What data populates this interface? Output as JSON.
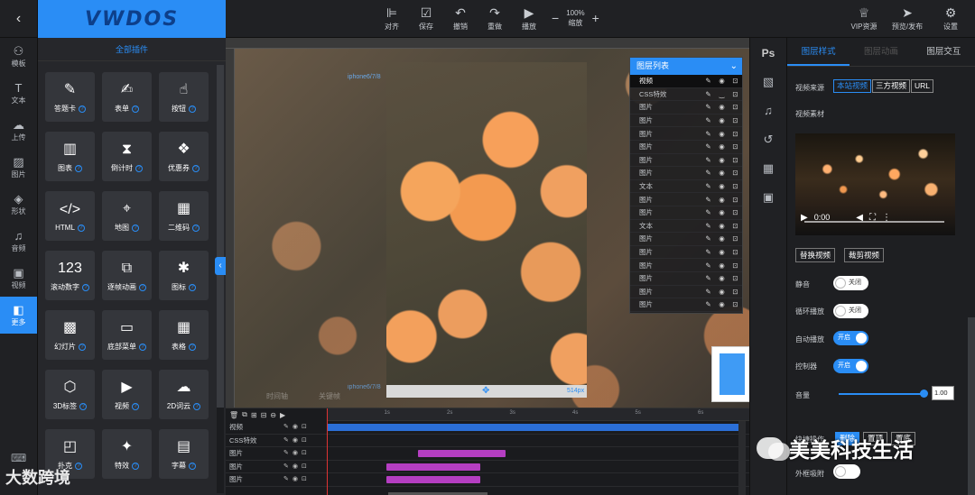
{
  "logo": "VWDOS",
  "topbar": {
    "tools": [
      {
        "icon": "align-icon",
        "glyph": "⊫",
        "label": "对齐"
      },
      {
        "icon": "save-icon",
        "glyph": "☑",
        "label": "保存"
      },
      {
        "icon": "undo-icon",
        "glyph": "↶",
        "label": "撤销"
      },
      {
        "icon": "redo-icon",
        "glyph": "↷",
        "label": "重做"
      },
      {
        "icon": "play-icon",
        "glyph": "▶",
        "label": "播放"
      }
    ],
    "zoom": {
      "minus": "−",
      "value": "100%",
      "label": "缩放",
      "plus": "+"
    },
    "right": [
      {
        "icon": "vip-icon",
        "glyph": "♕",
        "label": "VIP资源"
      },
      {
        "icon": "publish-icon",
        "glyph": "➤",
        "label": "预览/发布"
      },
      {
        "icon": "settings-icon",
        "glyph": "⚙",
        "label": "设置"
      }
    ]
  },
  "rail": [
    {
      "name": "templates",
      "glyph": "⚇",
      "label": "模板",
      "active": false
    },
    {
      "name": "text",
      "glyph": "T",
      "label": "文本",
      "active": false
    },
    {
      "name": "upload",
      "glyph": "☁",
      "label": "上传",
      "active": false
    },
    {
      "name": "image",
      "glyph": "▨",
      "label": "图片",
      "active": false
    },
    {
      "name": "shape",
      "glyph": "◈",
      "label": "形状",
      "active": false
    },
    {
      "name": "audio",
      "glyph": "♫",
      "label": "音频",
      "active": false
    },
    {
      "name": "video",
      "glyph": "▣",
      "label": "视频",
      "active": false
    },
    {
      "name": "more",
      "glyph": "◧",
      "label": "更多",
      "active": true
    }
  ],
  "widgets": {
    "title": "全部插件",
    "items": [
      {
        "icon": "edit-icon",
        "glyph": "✎",
        "label": "答题卡"
      },
      {
        "icon": "form-icon",
        "glyph": "✍",
        "label": "表单"
      },
      {
        "icon": "button-icon",
        "glyph": "☝",
        "label": "按钮"
      },
      {
        "icon": "chart-icon",
        "glyph": "▥",
        "label": "图表"
      },
      {
        "icon": "hourglass-icon",
        "glyph": "⧗",
        "label": "倒计时"
      },
      {
        "icon": "coupon-icon",
        "glyph": "❖",
        "label": "优惠券"
      },
      {
        "icon": "code-icon",
        "glyph": "</>",
        "label": "HTML"
      },
      {
        "icon": "map-pin-icon",
        "glyph": "⌖",
        "label": "地图"
      },
      {
        "icon": "qrcode-icon",
        "glyph": "▦",
        "label": "二维码"
      },
      {
        "icon": "number-icon",
        "glyph": "123",
        "label": "滚动数字"
      },
      {
        "icon": "frames-icon",
        "glyph": "⧉",
        "label": "逐帧动画"
      },
      {
        "icon": "star-icon",
        "glyph": "✱",
        "label": "图标"
      },
      {
        "icon": "slideshow-icon",
        "glyph": "▩",
        "label": "幻灯片"
      },
      {
        "icon": "bottom-menu-icon",
        "glyph": "▭",
        "label": "底部菜单"
      },
      {
        "icon": "table-icon",
        "glyph": "▦",
        "label": "表格"
      },
      {
        "icon": "cube-icon",
        "glyph": "⬡",
        "label": "3D标签"
      },
      {
        "icon": "video-icon",
        "glyph": "▶",
        "label": "视频"
      },
      {
        "icon": "cloud-icon",
        "glyph": "☁",
        "label": "2D词云"
      },
      {
        "icon": "shapes-icon",
        "glyph": "◰",
        "label": "扑克"
      },
      {
        "icon": "magic-icon",
        "glyph": "✦",
        "label": "特效"
      },
      {
        "icon": "subtitle-icon",
        "glyph": "▤",
        "label": "字幕"
      }
    ]
  },
  "canvas": {
    "phone_label_top": "iphone6/7/8",
    "phone_label_bottom": "iphone6/7/8",
    "phone_size": "514px",
    "move_glyph": "✥",
    "faded_left": "时间轴",
    "faded_mid": "关键帧"
  },
  "layers": {
    "title": "图层列表",
    "rows": [
      "视频",
      "CSS特效",
      "图片",
      "图片",
      "图片",
      "图片",
      "图片",
      "图片",
      "文本",
      "图片",
      "图片",
      "文本",
      "图片",
      "图片",
      "图片",
      "图片",
      "图片",
      "图片"
    ]
  },
  "timeline": {
    "tools": [
      "🗑",
      "⧉",
      "⊞",
      "⊟",
      "⊖",
      "▶"
    ],
    "ticks": [
      "1s",
      "2s",
      "3s",
      "4s",
      "5s",
      "6s"
    ],
    "rows": [
      {
        "name": "视频",
        "bar": {
          "start": 0.0,
          "end": 6.6,
          "color": "#2b6fd6"
        }
      },
      {
        "name": "CSS特效",
        "bar": null
      },
      {
        "name": "图片",
        "bar": {
          "start": 1.45,
          "end": 2.85,
          "color": "#b53ec2"
        }
      },
      {
        "name": "图片",
        "bar": {
          "start": 0.95,
          "end": 2.45,
          "color": "#b53ec2"
        }
      },
      {
        "name": "图片",
        "bar": {
          "start": 0.95,
          "end": 2.45,
          "color": "#b53ec2"
        }
      }
    ]
  },
  "rstrip": [
    {
      "icon": "photoshop-icon",
      "glyph": "Ps"
    },
    {
      "icon": "texture-icon",
      "glyph": "▧"
    },
    {
      "icon": "music-icon",
      "glyph": "♫"
    },
    {
      "icon": "history-icon",
      "glyph": "↺"
    },
    {
      "icon": "grid-icon",
      "glyph": "▦"
    },
    {
      "icon": "image-frame-icon",
      "glyph": "▣"
    }
  ],
  "props": {
    "tabs": [
      "图层样式",
      "图层动画",
      "图层交互"
    ],
    "source_label": "视频来源",
    "source_options": [
      "本站视频",
      "三方视频",
      "URL"
    ],
    "material_label": "视频素材",
    "video_time": "0:00",
    "replace_btn": "替换视频",
    "crop_btn": "裁剪视频",
    "mute_label": "静音",
    "mute_state": "关闭",
    "loop_label": "循环播放",
    "loop_state": "关闭",
    "autoplay_label": "自动播放",
    "autoplay_state": "开启",
    "controls_label": "控制器",
    "controls_state": "开启",
    "volume_label": "音量",
    "volume_value": "1.00",
    "volume_level": 1.0,
    "quick_label": "快捷操作",
    "quick_btns": [
      "删除",
      "置顶",
      "置底"
    ],
    "outline_label": "外框吸附"
  },
  "watermarks": {
    "wechat": "美美科技生活",
    "brand": "大数跨境"
  }
}
